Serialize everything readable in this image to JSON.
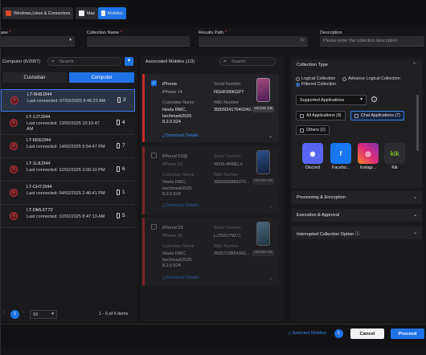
{
  "toolbar": {
    "tabs": [
      {
        "label": "Windows,Linux & Connectors"
      },
      {
        "label": "Mac"
      },
      {
        "label": "Mobiles"
      }
    ]
  },
  "form": {
    "case_label": "ase",
    "collection_name_label": "Collection Name",
    "results_path_label": "Results Path",
    "description_label": "Description",
    "description_placeholder": "Please enter the collection description"
  },
  "left": {
    "header": "Computer (6/2007)",
    "search_placeholder": "Search",
    "seg_custodian": "Custodian",
    "seg_computer": "Computer",
    "devices": [
      {
        "name": "LT-9H8J344",
        "connected": "Last connected: 07/02/2025 9:46:23 AM",
        "count": "3"
      },
      {
        "name": "LT-1J7J344",
        "connected": "Last connected: 13/02/2025 10:15:47 AM",
        "count": "4"
      },
      {
        "name": "LT-6K8J344",
        "connected": "Last connected: 14/02/2025 5:54:47 PM",
        "count": "7"
      },
      {
        "name": "LT-1L8J344",
        "connected": "Last connected: 12/02/2025 3:00:10 PM",
        "count": "6"
      },
      {
        "name": "LT-CH7J344",
        "connected": "Last connected: 04/02/2025 2:46:41 PM",
        "count": "1"
      },
      {
        "name": "LT-DML6T72",
        "connected": "Last connected: 12/02/2025 8:47:13 AM",
        "count": "5"
      }
    ],
    "pager": {
      "page": "1",
      "size": "10",
      "range": "1 - 6 of 6 items"
    }
  },
  "middle": {
    "header": "Associated Mobiles (1/3)",
    "search_placeholder": "Search",
    "cards": [
      {
        "title": "iPhone",
        "model": "iPhone 14",
        "serial_label": "Serial Number",
        "serial": "NGHFD6KGP7",
        "custodian_label": "Custodian Name",
        "custodian": "Neela RMC, bechmark2025 8.2.0.524",
        "imei_label": "IMEI Number",
        "imei": "358393417040240...",
        "capacity": "16/128 GB",
        "download": "Download Details"
      },
      {
        "title": "iPhone'13@",
        "model": "iPhone 13",
        "serial_label": "Serial Number",
        "serial": "W2XL4M9ELX",
        "custodian_label": "Custodian Name",
        "custodian": "Neela RMC, bechmark2025 8.2.0.524",
        "imei_label": "IMEI Number",
        "imei": "3582655865070...",
        "capacity": "25/128 GB",
        "download": "Download Details"
      },
      {
        "title": "iPhone'15",
        "model": "iPhone 15",
        "serial_label": "Serial Number",
        "serial": "LJT62V7W7J",
        "custodian_label": "Custodian Name",
        "custodian": "Neela RMC, bechmark2025 8.2.0.524",
        "imei_label": "IMEI Number",
        "imei": "3505718854360...",
        "capacity": "28/256 GB",
        "download": "Download Details"
      }
    ]
  },
  "right": {
    "collection_type": "Collection Type",
    "radios": [
      "Logical Collection",
      "Advance Logical Collection",
      "Filtered Collection"
    ],
    "dropdown": "Supported Applications",
    "chips": [
      {
        "label": "All Applications (9)"
      },
      {
        "label": "Chat Applications (7)"
      },
      {
        "label": "Others (2)"
      }
    ],
    "apps": [
      {
        "name": "Discord",
        "glyph": "◉",
        "color": "#5865f2"
      },
      {
        "name": "Facebo...",
        "glyph": "f",
        "color": "#1877f2"
      },
      {
        "name": "Instagr...",
        "glyph": "◎",
        "color": "#e1306c"
      },
      {
        "name": "Kik",
        "glyph": "kik",
        "color": "#2c2c31"
      }
    ],
    "sections": [
      "Processing & Encryption",
      "Execution & Approval",
      "Interrupted Collection Option"
    ]
  },
  "footer": {
    "selected_label": "Selected Mobiles",
    "selected_count": "1",
    "cancel": "Cancel",
    "proceed": "Proceed"
  }
}
